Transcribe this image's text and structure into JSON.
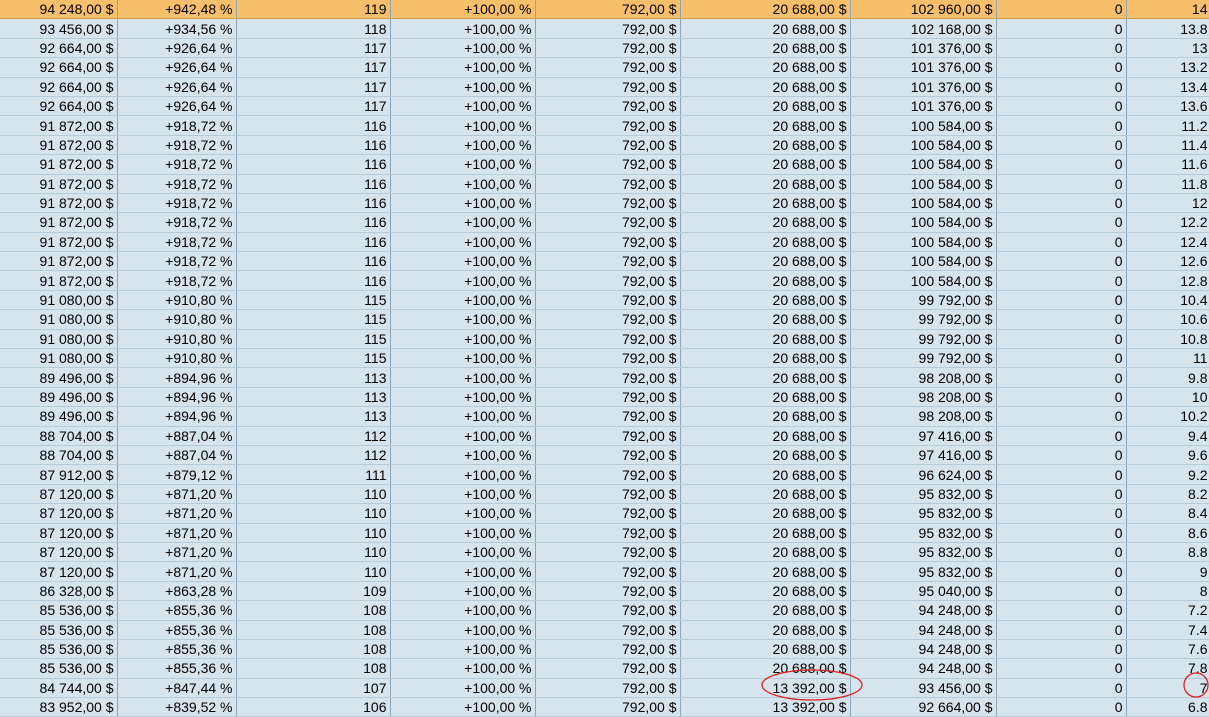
{
  "rows": [
    [
      "94 248,00 $",
      "+942,48 %",
      "119",
      "+100,00 %",
      "792,00 $",
      "20 688,00 $",
      "102 960,00 $",
      "0",
      "14"
    ],
    [
      "93 456,00 $",
      "+934,56 %",
      "118",
      "+100,00 %",
      "792,00 $",
      "20 688,00 $",
      "102 168,00 $",
      "0",
      "13.8"
    ],
    [
      "92 664,00 $",
      "+926,64 %",
      "117",
      "+100,00 %",
      "792,00 $",
      "20 688,00 $",
      "101 376,00 $",
      "0",
      "13"
    ],
    [
      "92 664,00 $",
      "+926,64 %",
      "117",
      "+100,00 %",
      "792,00 $",
      "20 688,00 $",
      "101 376,00 $",
      "0",
      "13.2"
    ],
    [
      "92 664,00 $",
      "+926,64 %",
      "117",
      "+100,00 %",
      "792,00 $",
      "20 688,00 $",
      "101 376,00 $",
      "0",
      "13.4"
    ],
    [
      "92 664,00 $",
      "+926,64 %",
      "117",
      "+100,00 %",
      "792,00 $",
      "20 688,00 $",
      "101 376,00 $",
      "0",
      "13.6"
    ],
    [
      "91 872,00 $",
      "+918,72 %",
      "116",
      "+100,00 %",
      "792,00 $",
      "20 688,00 $",
      "100 584,00 $",
      "0",
      "11.2"
    ],
    [
      "91 872,00 $",
      "+918,72 %",
      "116",
      "+100,00 %",
      "792,00 $",
      "20 688,00 $",
      "100 584,00 $",
      "0",
      "11.4"
    ],
    [
      "91 872,00 $",
      "+918,72 %",
      "116",
      "+100,00 %",
      "792,00 $",
      "20 688,00 $",
      "100 584,00 $",
      "0",
      "11.6"
    ],
    [
      "91 872,00 $",
      "+918,72 %",
      "116",
      "+100,00 %",
      "792,00 $",
      "20 688,00 $",
      "100 584,00 $",
      "0",
      "11.8"
    ],
    [
      "91 872,00 $",
      "+918,72 %",
      "116",
      "+100,00 %",
      "792,00 $",
      "20 688,00 $",
      "100 584,00 $",
      "0",
      "12"
    ],
    [
      "91 872,00 $",
      "+918,72 %",
      "116",
      "+100,00 %",
      "792,00 $",
      "20 688,00 $",
      "100 584,00 $",
      "0",
      "12.2"
    ],
    [
      "91 872,00 $",
      "+918,72 %",
      "116",
      "+100,00 %",
      "792,00 $",
      "20 688,00 $",
      "100 584,00 $",
      "0",
      "12.4"
    ],
    [
      "91 872,00 $",
      "+918,72 %",
      "116",
      "+100,00 %",
      "792,00 $",
      "20 688,00 $",
      "100 584,00 $",
      "0",
      "12.6"
    ],
    [
      "91 872,00 $",
      "+918,72 %",
      "116",
      "+100,00 %",
      "792,00 $",
      "20 688,00 $",
      "100 584,00 $",
      "0",
      "12.8"
    ],
    [
      "91 080,00 $",
      "+910,80 %",
      "115",
      "+100,00 %",
      "792,00 $",
      "20 688,00 $",
      "99 792,00 $",
      "0",
      "10.4"
    ],
    [
      "91 080,00 $",
      "+910,80 %",
      "115",
      "+100,00 %",
      "792,00 $",
      "20 688,00 $",
      "99 792,00 $",
      "0",
      "10.6"
    ],
    [
      "91 080,00 $",
      "+910,80 %",
      "115",
      "+100,00 %",
      "792,00 $",
      "20 688,00 $",
      "99 792,00 $",
      "0",
      "10.8"
    ],
    [
      "91 080,00 $",
      "+910,80 %",
      "115",
      "+100,00 %",
      "792,00 $",
      "20 688,00 $",
      "99 792,00 $",
      "0",
      "11"
    ],
    [
      "89 496,00 $",
      "+894,96 %",
      "113",
      "+100,00 %",
      "792,00 $",
      "20 688,00 $",
      "98 208,00 $",
      "0",
      "9.8"
    ],
    [
      "89 496,00 $",
      "+894,96 %",
      "113",
      "+100,00 %",
      "792,00 $",
      "20 688,00 $",
      "98 208,00 $",
      "0",
      "10"
    ],
    [
      "89 496,00 $",
      "+894,96 %",
      "113",
      "+100,00 %",
      "792,00 $",
      "20 688,00 $",
      "98 208,00 $",
      "0",
      "10.2"
    ],
    [
      "88 704,00 $",
      "+887,04 %",
      "112",
      "+100,00 %",
      "792,00 $",
      "20 688,00 $",
      "97 416,00 $",
      "0",
      "9.4"
    ],
    [
      "88 704,00 $",
      "+887,04 %",
      "112",
      "+100,00 %",
      "792,00 $",
      "20 688,00 $",
      "97 416,00 $",
      "0",
      "9.6"
    ],
    [
      "87 912,00 $",
      "+879,12 %",
      "111",
      "+100,00 %",
      "792,00 $",
      "20 688,00 $",
      "96 624,00 $",
      "0",
      "9.2"
    ],
    [
      "87 120,00 $",
      "+871,20 %",
      "110",
      "+100,00 %",
      "792,00 $",
      "20 688,00 $",
      "95 832,00 $",
      "0",
      "8.2"
    ],
    [
      "87 120,00 $",
      "+871,20 %",
      "110",
      "+100,00 %",
      "792,00 $",
      "20 688,00 $",
      "95 832,00 $",
      "0",
      "8.4"
    ],
    [
      "87 120,00 $",
      "+871,20 %",
      "110",
      "+100,00 %",
      "792,00 $",
      "20 688,00 $",
      "95 832,00 $",
      "0",
      "8.6"
    ],
    [
      "87 120,00 $",
      "+871,20 %",
      "110",
      "+100,00 %",
      "792,00 $",
      "20 688,00 $",
      "95 832,00 $",
      "0",
      "8.8"
    ],
    [
      "87 120,00 $",
      "+871,20 %",
      "110",
      "+100,00 %",
      "792,00 $",
      "20 688,00 $",
      "95 832,00 $",
      "0",
      "9"
    ],
    [
      "86 328,00 $",
      "+863,28 %",
      "109",
      "+100,00 %",
      "792,00 $",
      "20 688,00 $",
      "95 040,00 $",
      "0",
      "8"
    ],
    [
      "85 536,00 $",
      "+855,36 %",
      "108",
      "+100,00 %",
      "792,00 $",
      "20 688,00 $",
      "94 248,00 $",
      "0",
      "7.2"
    ],
    [
      "85 536,00 $",
      "+855,36 %",
      "108",
      "+100,00 %",
      "792,00 $",
      "20 688,00 $",
      "94 248,00 $",
      "0",
      "7.4"
    ],
    [
      "85 536,00 $",
      "+855,36 %",
      "108",
      "+100,00 %",
      "792,00 $",
      "20 688,00 $",
      "94 248,00 $",
      "0",
      "7.6"
    ],
    [
      "85 536,00 $",
      "+855,36 %",
      "108",
      "+100,00 %",
      "792,00 $",
      "20 688,00 $",
      "94 248,00 $",
      "0",
      "7.8"
    ],
    [
      "84 744,00 $",
      "+847,44 %",
      "107",
      "+100,00 %",
      "792,00 $",
      "13 392,00 $",
      "93 456,00 $",
      "0",
      "7"
    ],
    [
      "83 952,00 $",
      "+839,52 %",
      "106",
      "+100,00 %",
      "792,00 $",
      "13 392,00 $",
      "92 664,00 $",
      "0",
      "6.8"
    ]
  ],
  "highlighted_row": 0,
  "colors": {
    "highlight": "#f8bf6a",
    "cell_bg": "#d6e4ee",
    "annotation": "#e0201c"
  }
}
